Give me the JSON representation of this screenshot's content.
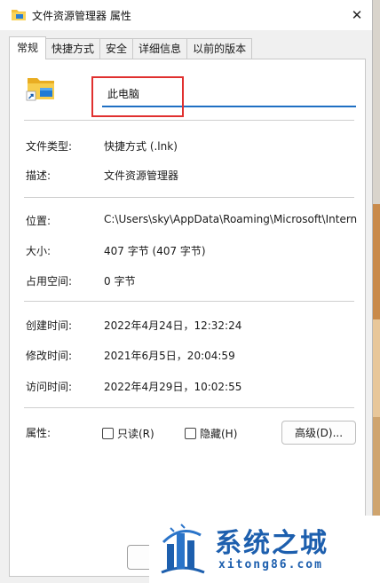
{
  "window": {
    "title": "文件资源管理器 属性",
    "close_glyph": "✕"
  },
  "tabs": [
    {
      "label": "常规",
      "active": true
    },
    {
      "label": "快捷方式",
      "active": false
    },
    {
      "label": "安全",
      "active": false
    },
    {
      "label": "详细信息",
      "active": false
    },
    {
      "label": "以前的版本",
      "active": false
    }
  ],
  "general": {
    "name_value": "此电脑",
    "file_type_label": "文件类型:",
    "file_type_value": "快捷方式 (.lnk)",
    "description_label": "描述:",
    "description_value": "文件资源管理器",
    "location_label": "位置:",
    "location_value": "C:\\Users\\sky\\AppData\\Roaming\\Microsoft\\Intern",
    "size_label": "大小:",
    "size_value": "407 字节 (407 字节)",
    "size_on_disk_label": "占用空间:",
    "size_on_disk_value": "0 字节",
    "created_label": "创建时间:",
    "created_value": "2022年4月24日，12:32:24",
    "modified_label": "修改时间:",
    "modified_value": "2021年6月5日，20:04:59",
    "accessed_label": "访问时间:",
    "accessed_value": "2022年4月29日，10:02:55",
    "attributes_label": "属性:",
    "readonly_label": "只读(R)",
    "hidden_label": "隐藏(H)",
    "advanced_button": "高级(D)..."
  },
  "watermark": {
    "title": "系统之城",
    "url": "xitong86.com"
  },
  "colors": {
    "accent": "#1f6fc3",
    "highlight": "#e0302f",
    "watermark": "#1d5fae"
  }
}
